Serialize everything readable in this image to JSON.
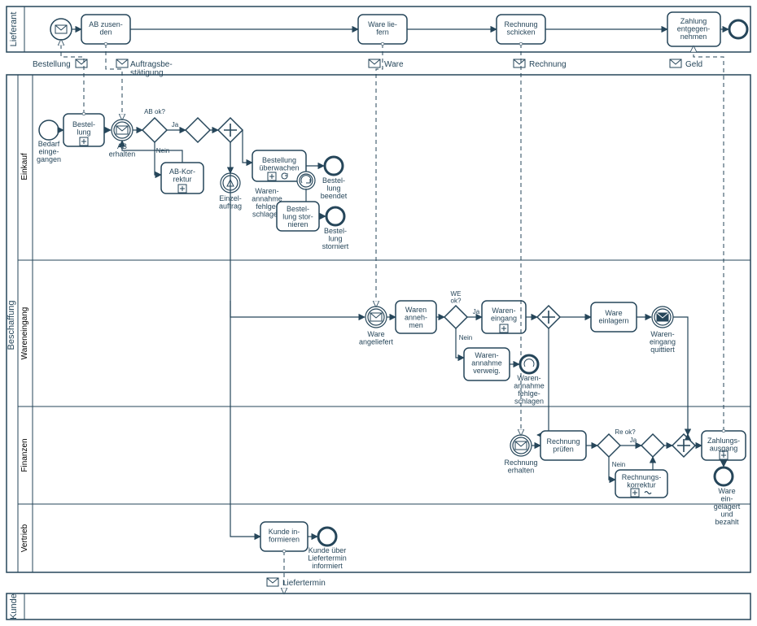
{
  "pools": {
    "lieferant": "Lieferant",
    "beschaffung": "Beschaffung",
    "kunde": "Kunde"
  },
  "lanes": {
    "einkauf": "Einkauf",
    "wareneingang": "Wareneingang",
    "finanzen": "Finanzen",
    "vertrieb": "Vertrieb"
  },
  "messages": {
    "bestellung": "Bestellung",
    "auftragsbestaetigung": "Auftragsbe-\nstätigung",
    "ware": "Ware",
    "rechnung": "Rechnung",
    "geld": "Geld",
    "liefertermin": "Liefertermin"
  },
  "tasks": {
    "ab_zusenden": "AB zusen-\nden",
    "ware_liefern": "Ware lie-\nfern",
    "rechnung_schicken": "Rechnung\nschicken",
    "zahlung_entgegennehmen": "Zahlung\nentgegen-\nnehmen",
    "bestellung": "Bestel-\nlung",
    "ab_korrektur": "AB-Kor-\nrektur",
    "bestellung_ueberwachen": "Bestellung\nüberwachen",
    "bestellung_stornieren": "Bestel-\nlung stor-\nnieren",
    "waren_annehmen": "Waren\nanneh-\nmen",
    "waren_eingang": "Waren-\neingang",
    "ware_einlagern": "Ware\neinlagern",
    "waren_annahme_verweig": "Waren-\nannahme\nverweig.",
    "rechnung_pruefen": "Rechnung\nprüfen",
    "rechnungskorrektur": "Rechnungs-\nkorrektur",
    "zahlungsausgang": "Zahlungs-\nausgang",
    "kunde_informieren": "Kunde in-\nformieren"
  },
  "events": {
    "bedarf_eingegangen": "Bedarf\neinge-\ngangen",
    "ab_erhalten": "AB\nerhalten",
    "einzelauftrag": "Einzel-\nauftrag",
    "warenannahme_fehlgeschlagen": "Waren-\nannahme\nfehlge-\nschlagen",
    "bestellung_beendet": "Bestel-\nlung\nbeendet",
    "bestellung_storniert": "Bestel-\nlung\nstorniert",
    "ware_angeliefert": "Ware\nangeliefert",
    "warenannahme_fehlgeschlagen2": "Waren-\nannahme\nfehlge-\nschlagen",
    "wareneingang_quittiert": "Waren-\neingang\nquittiert",
    "rechnung_erhalten": "Rechnung\nerhalten",
    "ware_eingelagert_bezahlt": "Ware\nein-\ngelagert\nund\nbezahlt",
    "kunde_informiert": "Kunde über\nLiefertermin\ninformiert"
  },
  "gateways": {
    "ab_ok": "AB ok?",
    "ja": "Ja",
    "nein": "Nein",
    "we_ok": "WE\nok?",
    "re_ok": "Re ok?"
  }
}
